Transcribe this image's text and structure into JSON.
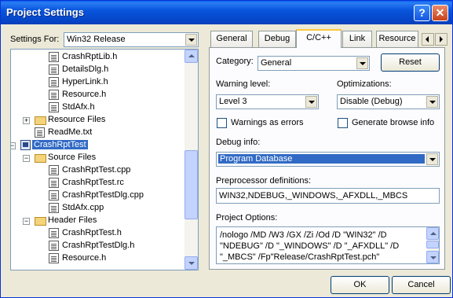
{
  "window": {
    "title": "Project Settings"
  },
  "titlebar_buttons": {
    "help": "?",
    "close": "✕"
  },
  "settings_for": {
    "label": "Settings For:",
    "value": "Win32 Release"
  },
  "tree": {
    "items": [
      {
        "label": "CrashRptLib.h",
        "type": "file"
      },
      {
        "label": "DetailsDlg.h",
        "type": "file"
      },
      {
        "label": "HyperLink.h",
        "type": "file"
      },
      {
        "label": "Resource.h",
        "type": "file"
      },
      {
        "label": "StdAfx.h",
        "type": "file"
      },
      {
        "label": "Resource Files",
        "type": "folder",
        "expander": "+"
      },
      {
        "label": "ReadMe.txt",
        "type": "file"
      },
      {
        "label": "CrashRptTest",
        "type": "project",
        "expander": "−",
        "selected": true
      },
      {
        "label": "Source Files",
        "type": "folder",
        "expander": "−"
      },
      {
        "label": "CrashRptTest.cpp",
        "type": "file"
      },
      {
        "label": "CrashRptTest.rc",
        "type": "file"
      },
      {
        "label": "CrashRptTestDlg.cpp",
        "type": "file"
      },
      {
        "label": "StdAfx.cpp",
        "type": "file"
      },
      {
        "label": "Header Files",
        "type": "folder",
        "expander": "−"
      },
      {
        "label": "CrashRptTest.h",
        "type": "file"
      },
      {
        "label": "CrashRptTestDlg.h",
        "type": "file"
      },
      {
        "label": "Resource.h",
        "type": "file"
      }
    ]
  },
  "tabs": [
    {
      "label": "General"
    },
    {
      "label": "Debug"
    },
    {
      "label": "C/C++",
      "active": true
    },
    {
      "label": "Link"
    },
    {
      "label": "Resource"
    }
  ],
  "cpp": {
    "category_label": "Category:",
    "category_value": "General",
    "reset_label": "Reset",
    "warning_label": "Warning level:",
    "warning_value": "Level 3",
    "optimizations_label": "Optimizations:",
    "optimizations_value": "Disable (Debug)",
    "warnings_as_errors": "Warnings as errors",
    "generate_browse_info": "Generate browse info",
    "debug_info_label": "Debug info:",
    "debug_info_value": "Program Database",
    "preprocessor_label": "Preprocessor definitions:",
    "preprocessor_value": "WIN32,NDEBUG,_WINDOWS,_AFXDLL,_MBCS",
    "project_options_label": "Project Options:",
    "project_options_value": "/nologo /MD /W3 /GX /Zi /Od /D \"WIN32\" /D\n\"NDEBUG\" /D \"_WINDOWS\" /D \"_AFXDLL\" /D\n\"_MBCS\" /Fp\"Release/CrashRptTest.pch\""
  },
  "footer": {
    "ok": "OK",
    "cancel": "Cancel"
  }
}
